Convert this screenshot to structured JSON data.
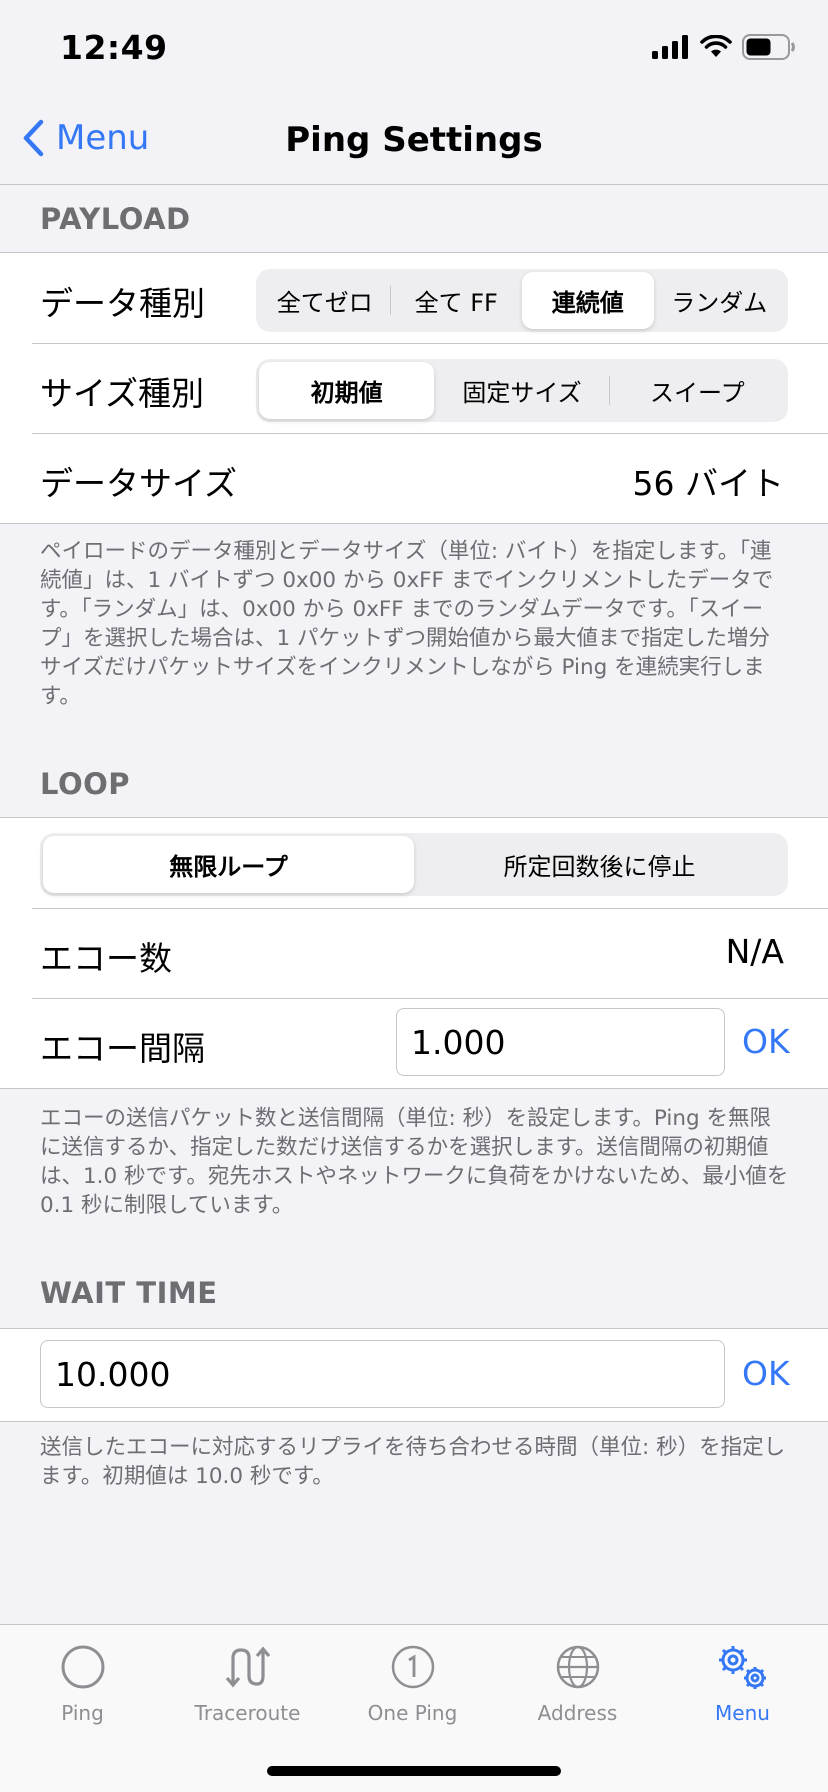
{
  "status": {
    "time": "12:49"
  },
  "nav": {
    "back_label": "Menu",
    "title": "Ping Settings"
  },
  "payload": {
    "header": "PAYLOAD",
    "data_type_label": "データ種別",
    "data_type_options": [
      "全てゼロ",
      "全て FF",
      "連続値",
      "ランダム"
    ],
    "data_type_selected": "連続値",
    "size_type_label": "サイズ種別",
    "size_type_options": [
      "初期値",
      "固定サイズ",
      "スイープ"
    ],
    "size_type_selected": "初期値",
    "data_size_label": "データサイズ",
    "data_size_value": "56 バイト",
    "footer": "ペイロードのデータ種別とデータサイズ（単位: バイト）を指定します。「連続値」は、1 バイトずつ 0x00 から 0xFF までインクリメントしたデータです。「ランダム」は、0x00 から 0xFF までのランダムデータです。「スイープ」を選択した場合は、1 パケットずつ開始値から最大値まで指定した増分サイズだけパケットサイズをインクリメントしながら Ping を連続実行します。"
  },
  "loop": {
    "header": "LOOP",
    "options": [
      "無限ループ",
      "所定回数後に停止"
    ],
    "selected": "無限ループ",
    "echo_count_label": "エコー数",
    "echo_count_value": "N/A",
    "echo_interval_label": "エコー間隔",
    "echo_interval_value": "1.000",
    "ok_label": "OK",
    "footer": "エコーの送信パケット数と送信間隔（単位: 秒）を設定します。Ping を無限に送信するか、指定した数だけ送信するかを選択します。送信間隔の初期値は、1.0 秒です。宛先ホストやネットワークに負荷をかけないため、最小値を 0.1 秒に制限しています。"
  },
  "wait": {
    "header": "WAIT TIME",
    "value": "10.000",
    "ok_label": "OK",
    "footer": "送信したエコーに対応するリプライを待ち合わせる時間（単位: 秒）を指定します。初期値は 10.0 秒です。"
  },
  "tabs": [
    {
      "label": "Ping",
      "icon": "circle-icon"
    },
    {
      "label": "Traceroute",
      "icon": "traceroute-icon"
    },
    {
      "label": "One Ping",
      "icon": "one-ping-icon"
    },
    {
      "label": "Address",
      "icon": "globe-icon"
    },
    {
      "label": "Menu",
      "icon": "gears-icon",
      "active": true
    }
  ],
  "colors": {
    "accent": "#3478f6",
    "background": "#f2f2f7",
    "secondary_text": "#6d6d72"
  }
}
